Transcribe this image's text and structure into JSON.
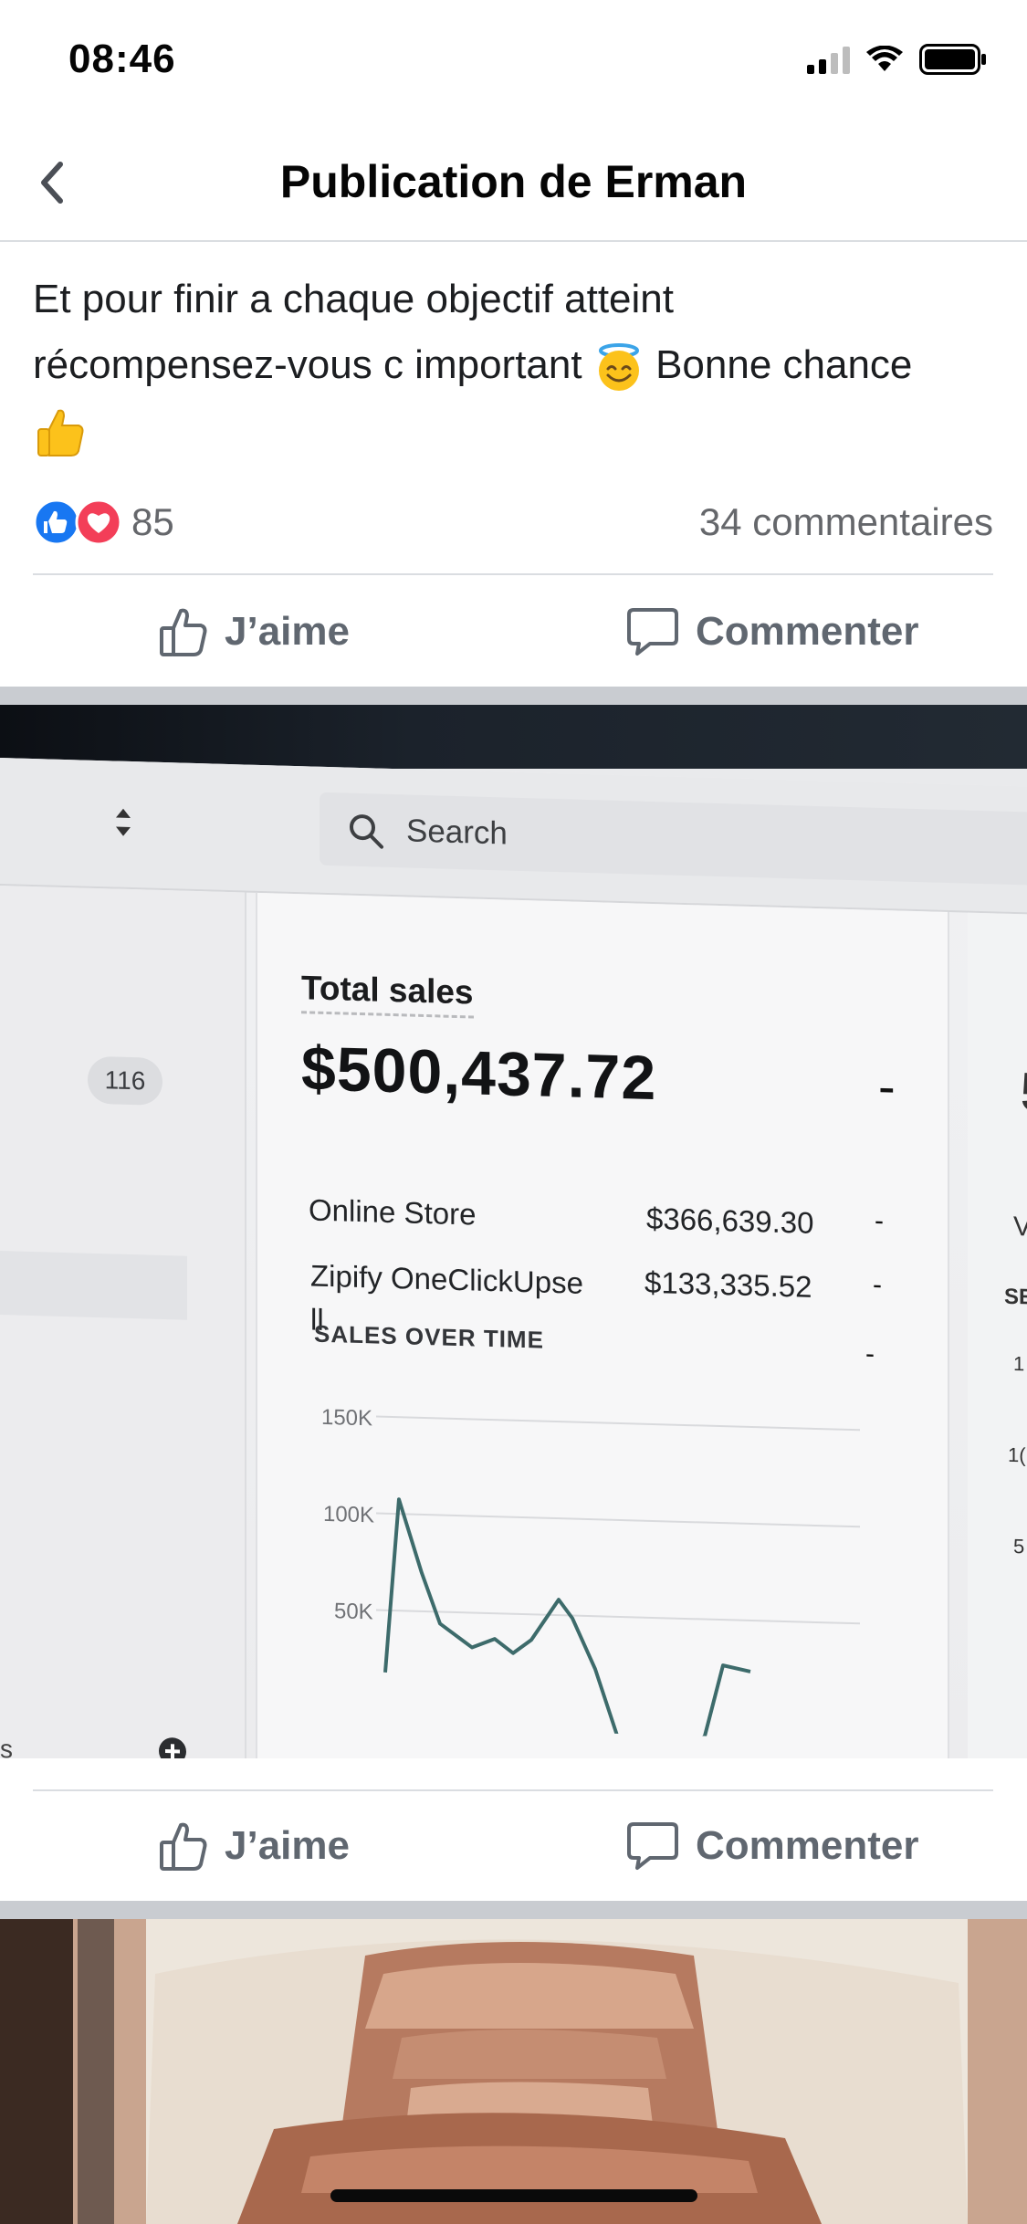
{
  "status_bar": {
    "time": "08:46"
  },
  "header": {
    "title": "Publication de Erman"
  },
  "post": {
    "text_line1": "Et pour finir a chaque objectif atteint",
    "text_line2_a": "récompensez-vous c important",
    "text_line2_b": "Bonne chance",
    "emojis": [
      "smiling-face-with-halo-icon",
      "thumbs-up-icon"
    ]
  },
  "reactions": {
    "count": "85",
    "comments": "34 commentaires",
    "icons": [
      "like-icon",
      "love-icon"
    ]
  },
  "actions": {
    "like_label": "J’aime",
    "comment_label": "Commenter"
  },
  "photo_screen": {
    "search_label": "Search",
    "badge": "116",
    "total_sales_label": "Total sales",
    "total_sales_value": "$500,437.72",
    "dash": "-",
    "rows": [
      {
        "label": "Online Store",
        "value": "$366,639.30"
      },
      {
        "label_line1": "Zipify OneClickUpse",
        "label_line2": "ll",
        "value": "$133,335.52"
      }
    ],
    "sales_over_time_title": "SALES OVER TIME",
    "y_ticks": [
      "150K",
      "100K",
      "50K"
    ],
    "edge_letters": [
      "5",
      "V",
      "SE",
      "1",
      "1(",
      "5"
    ],
    "sidebar_letter": "s"
  },
  "colors": {
    "accent_blue": "#1877f2",
    "love_red": "#f33e58",
    "text_gray": "#65676b",
    "chart_line": "#3d6b6b"
  }
}
